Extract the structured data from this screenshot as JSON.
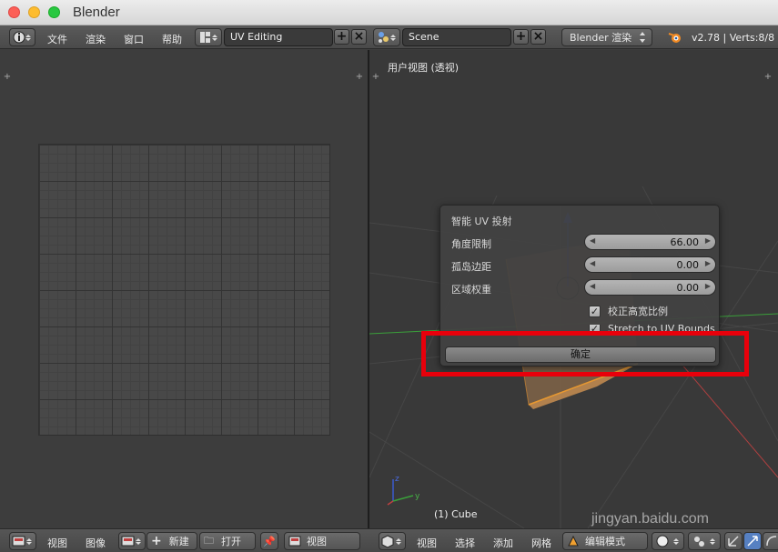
{
  "window": {
    "title": "Blender"
  },
  "top_header": {
    "menus": [
      "文件",
      "渲染",
      "窗口",
      "帮助"
    ],
    "screen_layout": "UV Editing",
    "scene": "Scene",
    "render_engine": "Blender 渲染",
    "status": "v2.78 | Verts:8/8 |"
  },
  "viewport": {
    "title": "用户视图 (透视)",
    "object_label": "(1) Cube"
  },
  "operator_panel": {
    "title": "智能 UV 投射",
    "fields": [
      {
        "label": "角度限制",
        "value": "66.00"
      },
      {
        "label": "孤岛边距",
        "value": "0.00"
      },
      {
        "label": "区域权重",
        "value": "0.00"
      }
    ],
    "checkboxes": [
      {
        "label": "校正高宽比例",
        "checked": true
      },
      {
        "label": "Stretch to UV Bounds",
        "checked": true
      }
    ],
    "confirm_label": "确定"
  },
  "uv_footer": {
    "view": "视图",
    "image": "图像",
    "new": "新建",
    "open": "打开",
    "view_select": "视图"
  },
  "view3d_footer": {
    "view": "视图",
    "select": "选择",
    "add": "添加",
    "mesh": "网格",
    "mode": "编辑模式"
  },
  "watermark": "jingyan.baidu.com"
}
